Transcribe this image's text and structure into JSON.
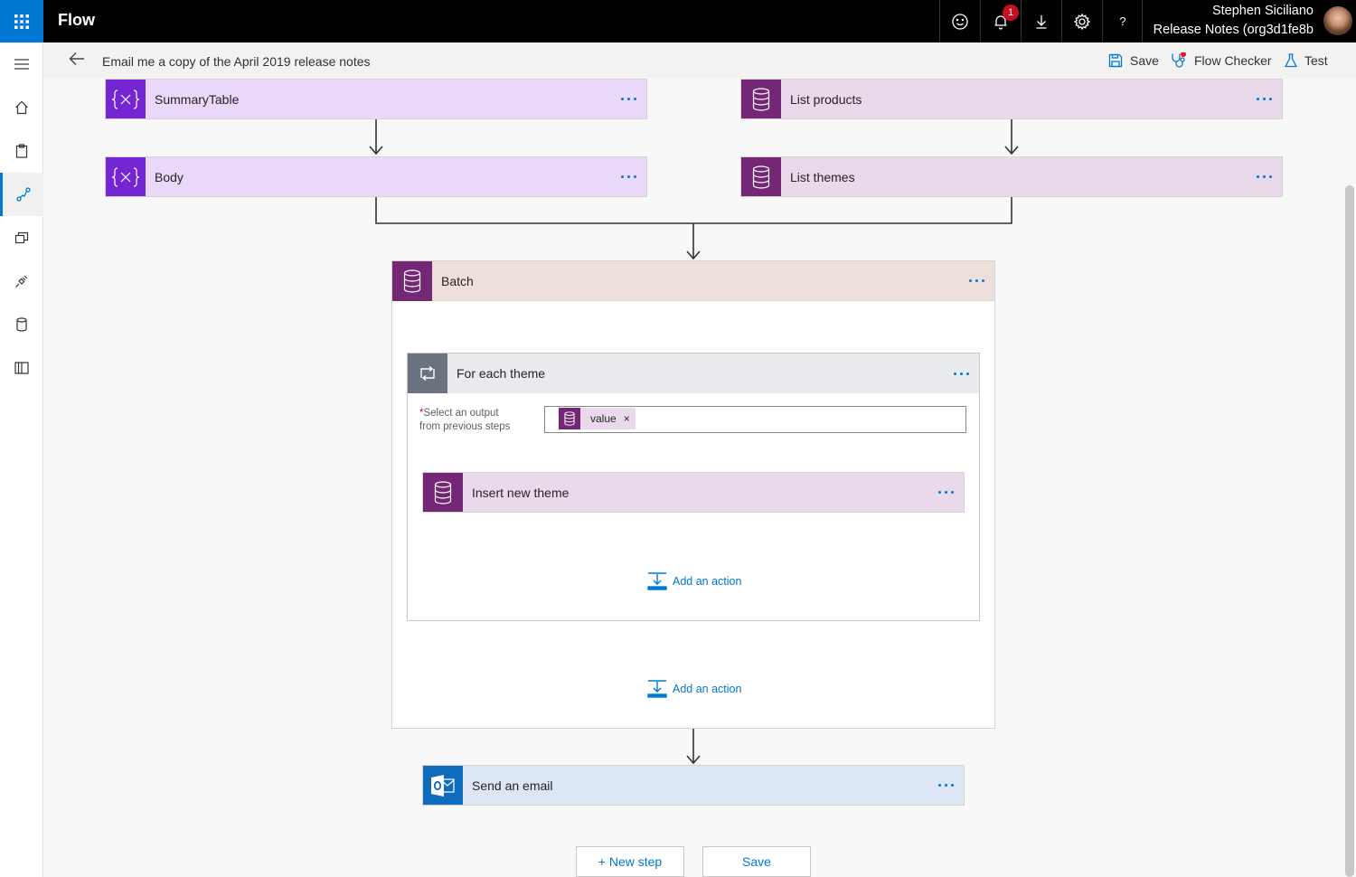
{
  "app": {
    "title": "Flow",
    "notification_count": "1",
    "help_label": "?"
  },
  "user": {
    "name": "Stephen Siciliano",
    "environment": "Release Notes (org3d1fe8b"
  },
  "header": {
    "flow_name": "Email me a copy of the April 2019 release notes",
    "save": "Save",
    "flow_checker": "Flow Checker",
    "test": "Test"
  },
  "steps": {
    "summary_table": "SummaryTable",
    "body": "Body",
    "list_products": "List products",
    "list_themes": "List themes",
    "batch": "Batch",
    "for_each": "For each theme",
    "select_output_label_1": "Select an output",
    "select_output_label_2": "from previous steps",
    "required_mark": "*",
    "token_value": "value",
    "token_remove": "×",
    "insert_theme": "Insert new theme",
    "add_action_inner": "Add an action",
    "add_action_outer": "Add an action",
    "send_email": "Send an email"
  },
  "footer": {
    "new_step": "+ New step",
    "save": "Save"
  },
  "colors": {
    "brand": "#0078d4",
    "variable": "#7426d4",
    "dataverse": "#742774",
    "outlook": "#0f6cbd",
    "topbar": "#000000"
  }
}
